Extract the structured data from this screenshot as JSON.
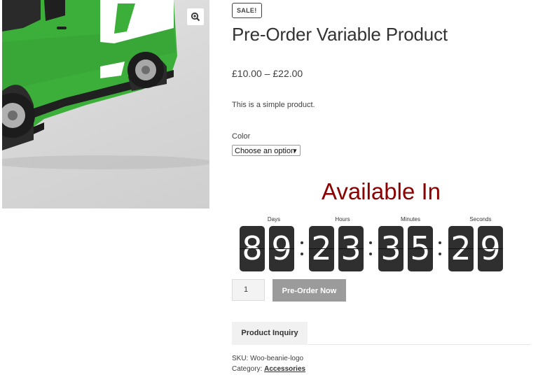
{
  "product": {
    "badge": "SALE!",
    "title": "Pre-Order Variable Product",
    "price": "£10.00 – £22.00",
    "description": "This is a simple product.",
    "attribute_label": "Color",
    "select_value": "Choose an option",
    "zoom_icon": "magnifier-plus-icon",
    "image_description_colors": {
      "van": "#3cae3a",
      "backdrop": "#d9d9d9"
    }
  },
  "countdown": {
    "heading": "Available In",
    "heading_color": "#8b0000",
    "labels": {
      "days": "Days",
      "hours": "Hours",
      "minutes": "Minutes",
      "seconds": "Seconds"
    },
    "digits": {
      "d1": "8",
      "d2": "9",
      "h1": "2",
      "h2": "3",
      "m1": "3",
      "m2": "5",
      "s1": "2",
      "s2": "9"
    }
  },
  "cart": {
    "quantity": "1",
    "button_label": "Pre-Order Now"
  },
  "tabs": {
    "inquiry_label": "Product Inquiry"
  },
  "meta": {
    "sku_label": "SKU: ",
    "sku_value": "Woo-beanie-logo",
    "category_label": "Category: ",
    "category_value": "Accessories"
  }
}
